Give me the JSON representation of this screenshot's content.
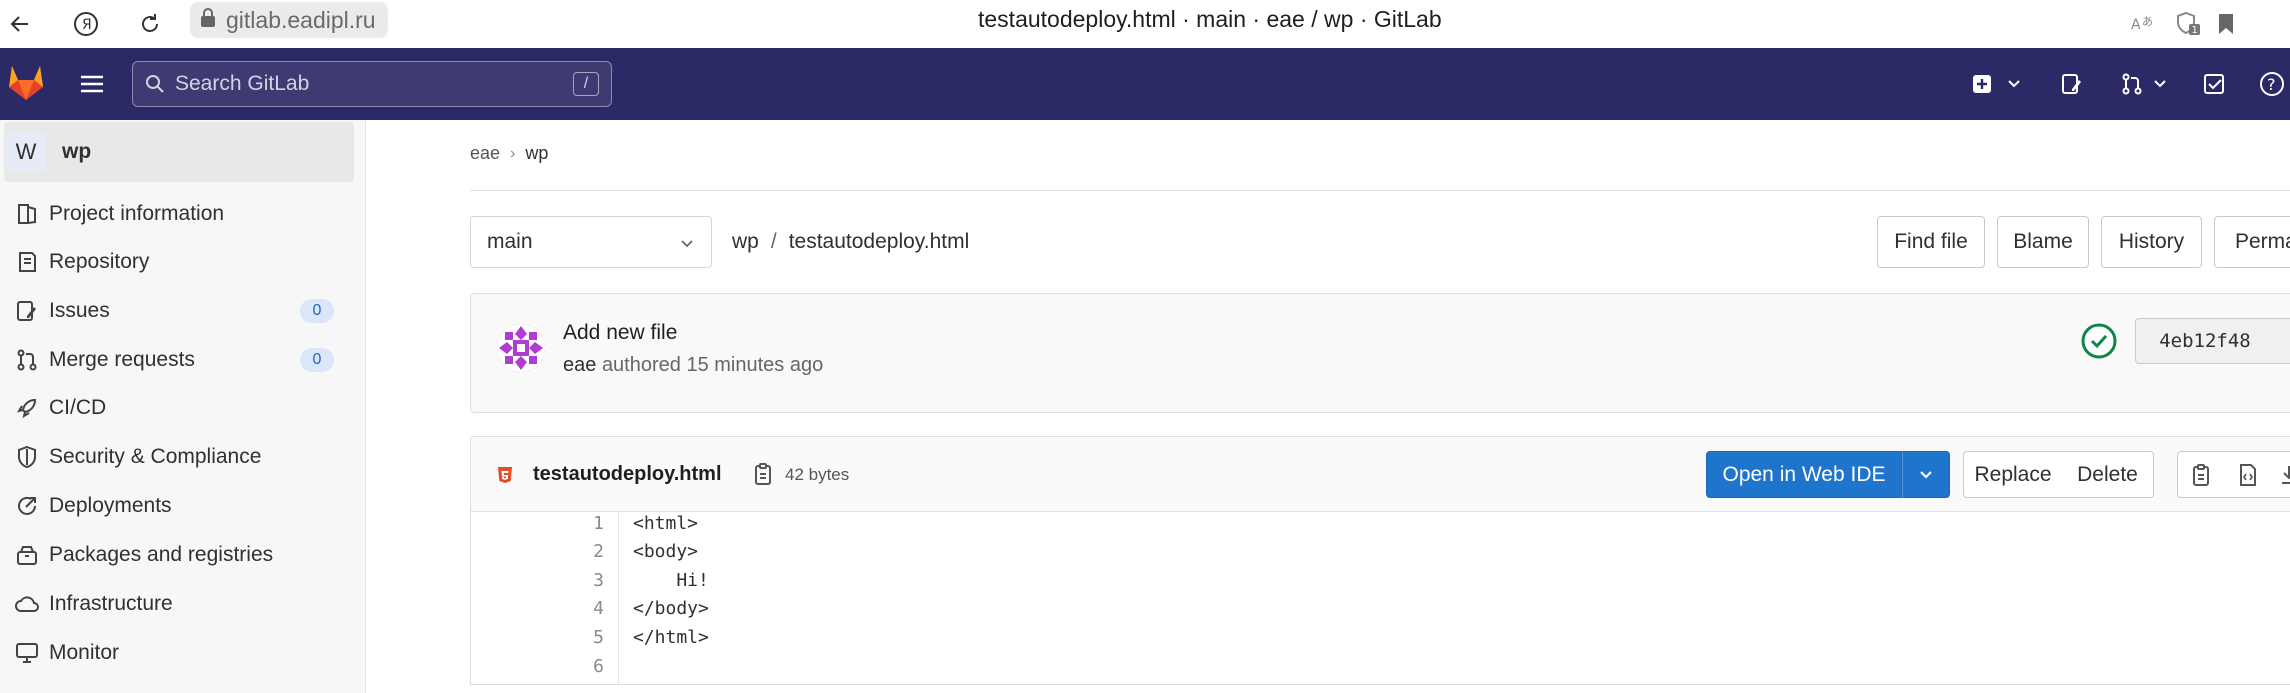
{
  "browser": {
    "url": "gitlab.eadipl.ru",
    "title": "testautodeploy.html · main · eae / wp · GitLab"
  },
  "topnav": {
    "search_placeholder": "Search GitLab",
    "search_shortcut": "/"
  },
  "sidebar": {
    "project_initial": "W",
    "project_name": "wp",
    "items": [
      {
        "label": "Project information",
        "icon": "project-info-icon"
      },
      {
        "label": "Repository",
        "icon": "repository-icon"
      },
      {
        "label": "Issues",
        "icon": "issues-icon",
        "badge": "0"
      },
      {
        "label": "Merge requests",
        "icon": "merge-request-icon",
        "badge": "0"
      },
      {
        "label": "CI/CD",
        "icon": "rocket-icon"
      },
      {
        "label": "Security & Compliance",
        "icon": "shield-icon"
      },
      {
        "label": "Deployments",
        "icon": "deployments-icon"
      },
      {
        "label": "Packages and registries",
        "icon": "package-icon"
      },
      {
        "label": "Infrastructure",
        "icon": "cloud-icon"
      },
      {
        "label": "Monitor",
        "icon": "monitor-icon"
      }
    ]
  },
  "breadcrumb": {
    "group": "eae",
    "project": "wp"
  },
  "file_nav": {
    "branch": "main",
    "path_root": "wp",
    "path_sep": "/",
    "path_file": "testautodeploy.html",
    "buttons": [
      "Find file",
      "Blame",
      "History",
      "Perma"
    ]
  },
  "commit": {
    "message": "Add new file",
    "author": "eae",
    "authored_text": "authored 15 minutes ago",
    "sha": "4eb12f48",
    "status": "passed"
  },
  "file": {
    "name": "testautodeploy.html",
    "size": "42 bytes",
    "open_ide": "Open in Web IDE",
    "replace": "Replace",
    "delete": "Delete"
  },
  "code": {
    "lines": [
      {
        "num": "1",
        "text": "<html>"
      },
      {
        "num": "2",
        "text": "<body>"
      },
      {
        "num": "3",
        "text": "    Hi!"
      },
      {
        "num": "4",
        "text": "</body>"
      },
      {
        "num": "5",
        "text": "</html>"
      },
      {
        "num": "6",
        "text": ""
      }
    ]
  },
  "colors": {
    "nav_bg": "#2c2a66",
    "primary": "#1f75cb",
    "success": "#108548",
    "badge_bg": "#dbe7f8"
  }
}
